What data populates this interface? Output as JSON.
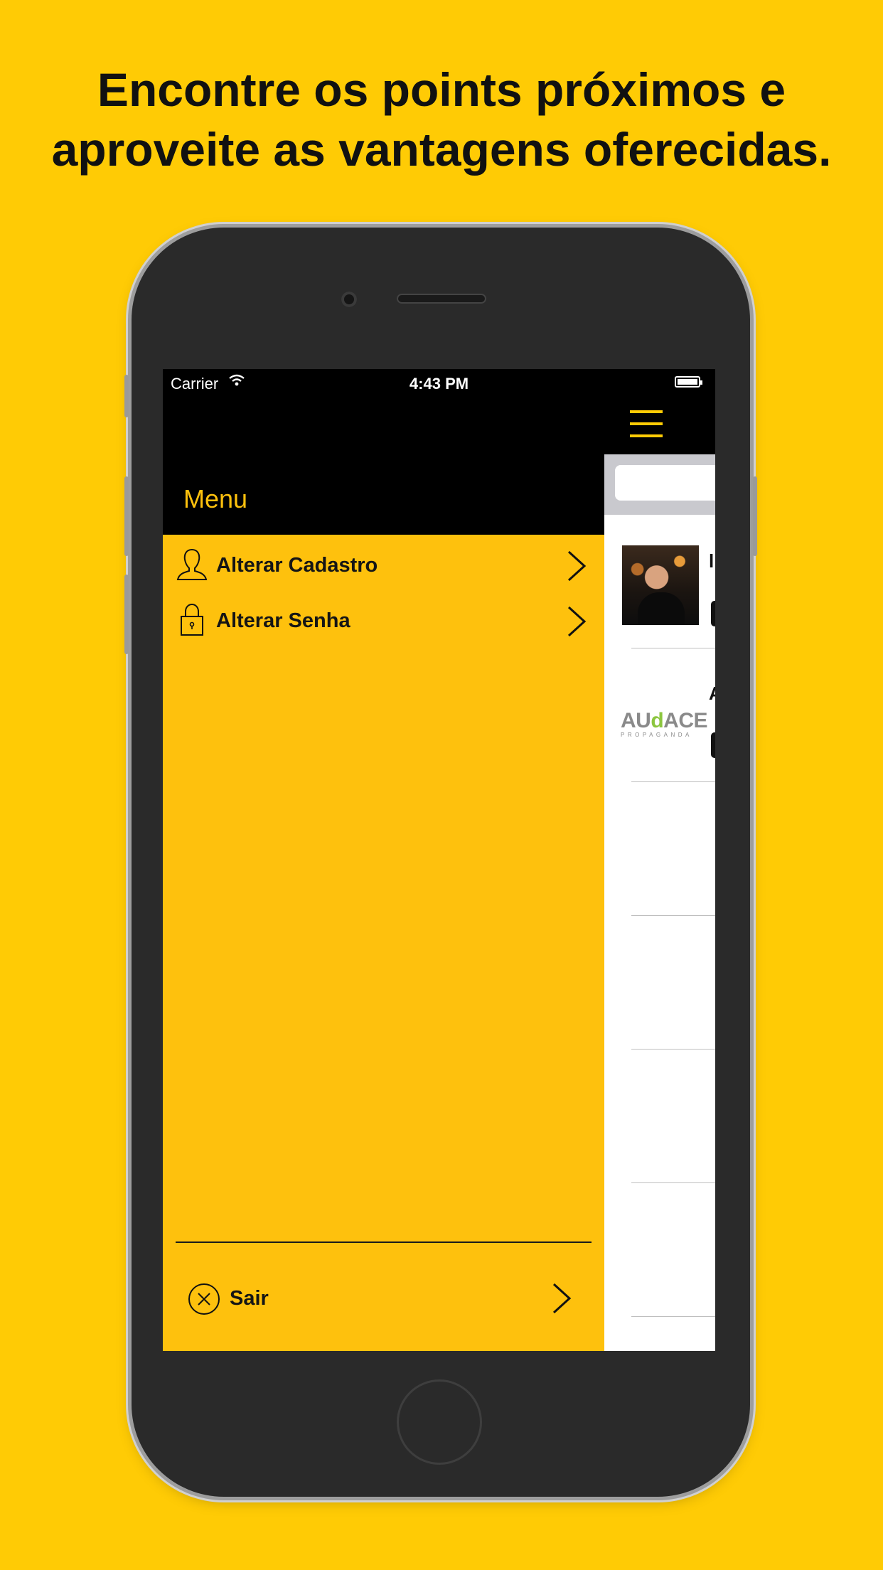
{
  "headline": {
    "line1": "Encontre os points próximos e",
    "line2": "aproveite as vantagens oferecidas."
  },
  "status_bar": {
    "carrier": "Carrier",
    "time": "4:43 PM"
  },
  "drawer": {
    "title": "Menu",
    "items": [
      {
        "label": "Alterar Cadastro",
        "icon": "user-icon"
      },
      {
        "label": "Alterar Senha",
        "icon": "lock-icon"
      }
    ],
    "logout": {
      "label": "Sair",
      "icon": "close-circle-icon"
    }
  },
  "main": {
    "list_items": [
      {
        "image": "person-photo",
        "peek_text": "l"
      },
      {
        "image": "audace-logo",
        "peek_text": "A",
        "logo_text": "AUDACE",
        "logo_sub": "PROPAGANDA"
      }
    ]
  },
  "colors": {
    "background": "#FFCB05",
    "drawer": "#FEC10D",
    "header": "#000000"
  }
}
